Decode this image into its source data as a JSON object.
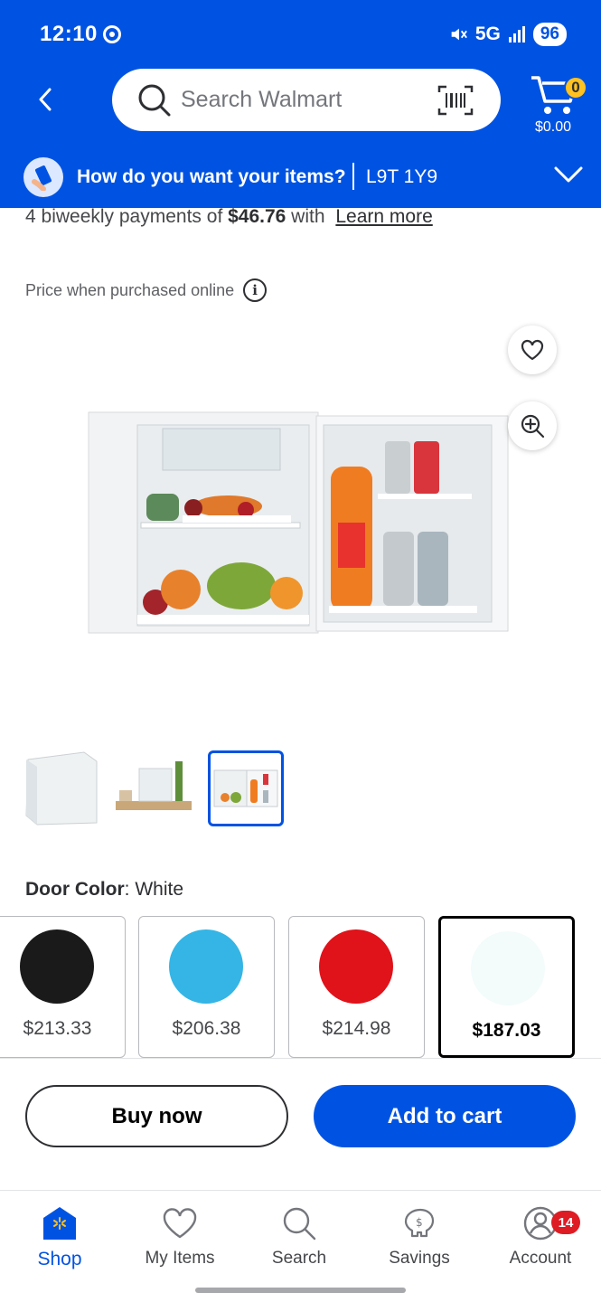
{
  "status_bar": {
    "time": "12:10",
    "network": "5G",
    "battery": "96"
  },
  "header": {
    "search_placeholder": "Search Walmart",
    "cart_count": "0",
    "cart_total": "$0.00"
  },
  "delivery": {
    "prompt": "How do you want your items?",
    "postal_code": "L9T 1Y9"
  },
  "payments": {
    "prefix": "4 biweekly payments of ",
    "amount": "$46.76",
    "suffix": " with",
    "learn_more": "Learn more"
  },
  "price_note": "Price when purchased online",
  "product": {
    "image_icon": "mini-fridge-image",
    "thumbnail_count": 3,
    "selected_thumbnail": 3
  },
  "door_color": {
    "label": "Door Color",
    "value": "White"
  },
  "swatches": [
    {
      "color": "#1a1a1a",
      "price": "$213.33"
    },
    {
      "color": "#34b5e5",
      "price": "$206.38"
    },
    {
      "color": "#e0121a",
      "price": "$214.98"
    },
    {
      "color": "#f3fbfb",
      "price": "$187.03",
      "selected": true
    }
  ],
  "actions": {
    "buy_now": "Buy now",
    "add_to_cart": "Add to cart"
  },
  "bottom_nav": {
    "items": [
      {
        "label": "Shop",
        "icon": "shop-icon",
        "active": true
      },
      {
        "label": "My Items",
        "icon": "heart-icon"
      },
      {
        "label": "Search",
        "icon": "search-icon"
      },
      {
        "label": "Savings",
        "icon": "piggy-bank-icon"
      },
      {
        "label": "Account",
        "icon": "account-icon",
        "badge": "14"
      }
    ]
  },
  "colors": {
    "brand_blue": "#0053e2",
    "spark_yellow": "#ffc220",
    "badge_red": "#de1c24"
  }
}
